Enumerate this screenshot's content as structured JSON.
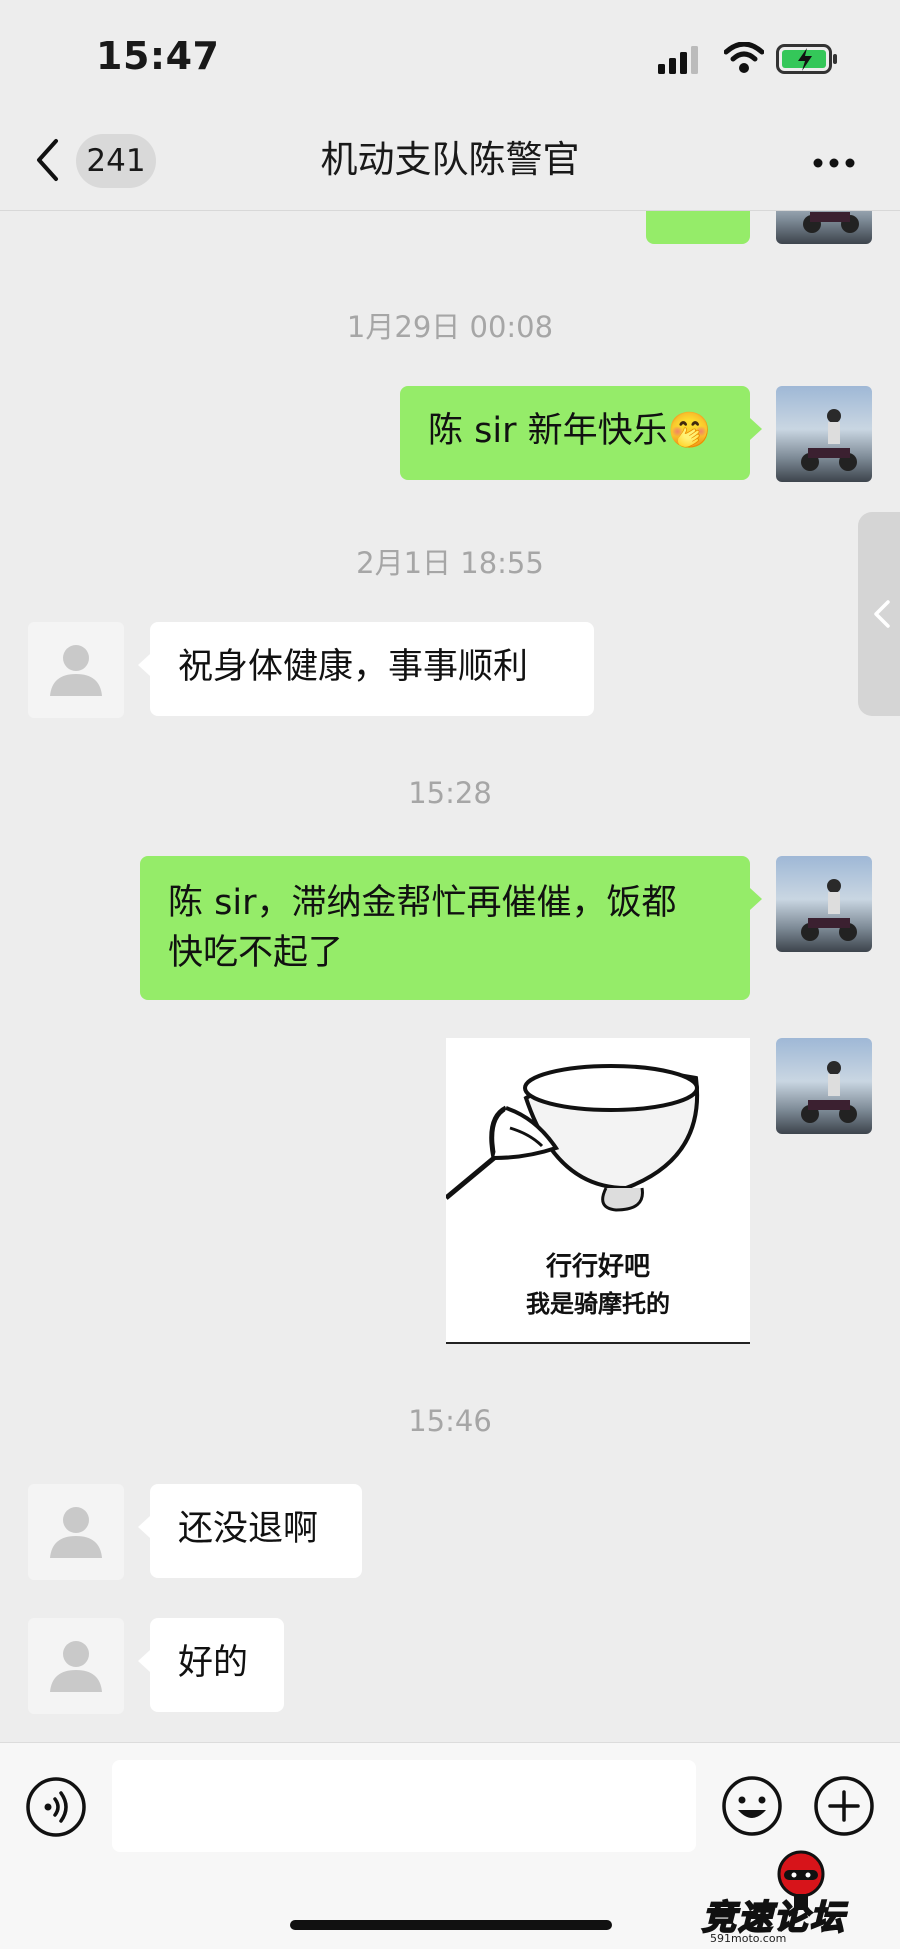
{
  "status_bar": {
    "time": "15:47"
  },
  "nav": {
    "back_count": "241",
    "title": "机动支队陈警官"
  },
  "messages": [
    {
      "type": "timestamp",
      "text": "1月29日 00:08"
    },
    {
      "type": "text",
      "side": "right",
      "text": "陈 sir 新年快乐",
      "emoji": "🤭"
    },
    {
      "type": "timestamp",
      "text": "2月1日 18:55"
    },
    {
      "type": "text",
      "side": "left",
      "text": "祝身体健康，事事顺利"
    },
    {
      "type": "timestamp",
      "text": "15:28"
    },
    {
      "type": "text",
      "side": "right",
      "line1": "陈 sir，滞纳金帮忙再催催，饭都",
      "line2": "快吃不起了"
    },
    {
      "type": "sticker",
      "side": "right",
      "line1": "行行好吧",
      "line2": "我是骑摩托的"
    },
    {
      "type": "timestamp",
      "text": "15:46"
    },
    {
      "type": "text",
      "side": "left",
      "text": "还没退啊"
    },
    {
      "type": "text",
      "side": "left",
      "text": "好的"
    }
  ],
  "watermark": {
    "text": "竞速论坛",
    "sub": "591moto.com"
  },
  "colors": {
    "background": "#ededed",
    "outgoing_bubble": "#95ec69",
    "incoming_bubble": "#ffffff",
    "timestamp": "#a6a6a6"
  },
  "icons": [
    "signal-icon",
    "wifi-icon",
    "battery-charging-icon",
    "back-icon",
    "more-icon",
    "voice-icon",
    "emoji-icon",
    "plus-icon",
    "default-avatar-icon"
  ]
}
